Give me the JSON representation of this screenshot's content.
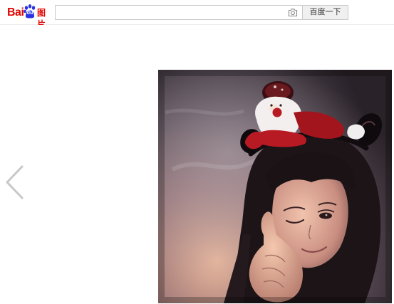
{
  "header": {
    "logo": {
      "brand_text": "Bai",
      "paw_text": "du",
      "product_text": "图片"
    },
    "search": {
      "value": "",
      "placeholder": "",
      "camera_icon": "camera-icon"
    },
    "search_button_label": "百度一下"
  },
  "viewer": {
    "prev_icon": "chevron-left-icon",
    "image": {
      "description_icon": "photo"
    }
  },
  "colors": {
    "brand_red": "#e10601",
    "brand_blue": "#2932e1",
    "border": "#c9c9c9",
    "button_bg": "#f0f0f0",
    "arrow": "#c8c8c8"
  }
}
